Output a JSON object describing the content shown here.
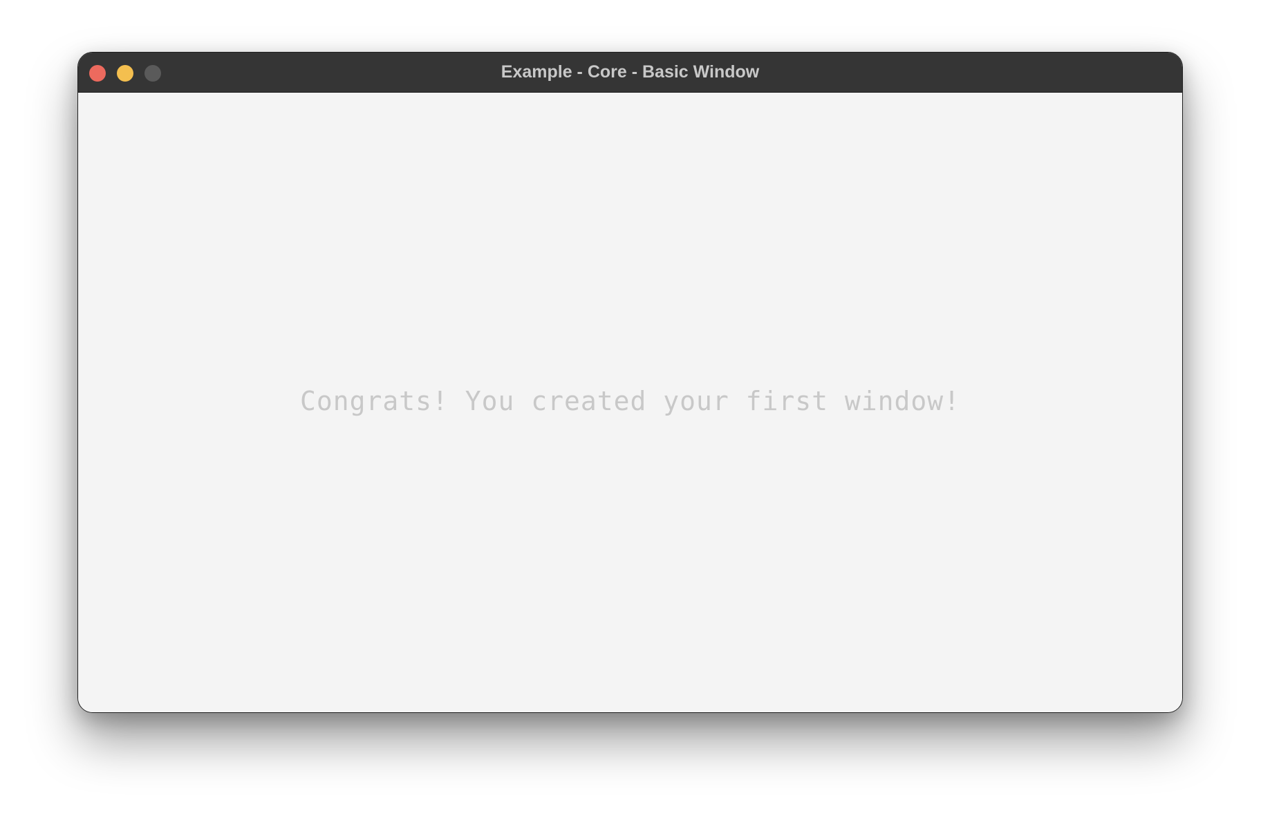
{
  "window": {
    "title": "Example - Core - Basic Window",
    "controls": {
      "close_icon": "close-icon",
      "minimize_icon": "minimize-icon",
      "zoom_icon": "zoom-icon"
    }
  },
  "content": {
    "message": "Congrats! You created your first window!"
  },
  "colors": {
    "titlebar": "#353535",
    "background": "#f4f4f4",
    "message_text": "#c8c8c8",
    "close": "#ed6a5e",
    "minimize": "#f4bf4f",
    "zoom": "#5a5a5a"
  }
}
